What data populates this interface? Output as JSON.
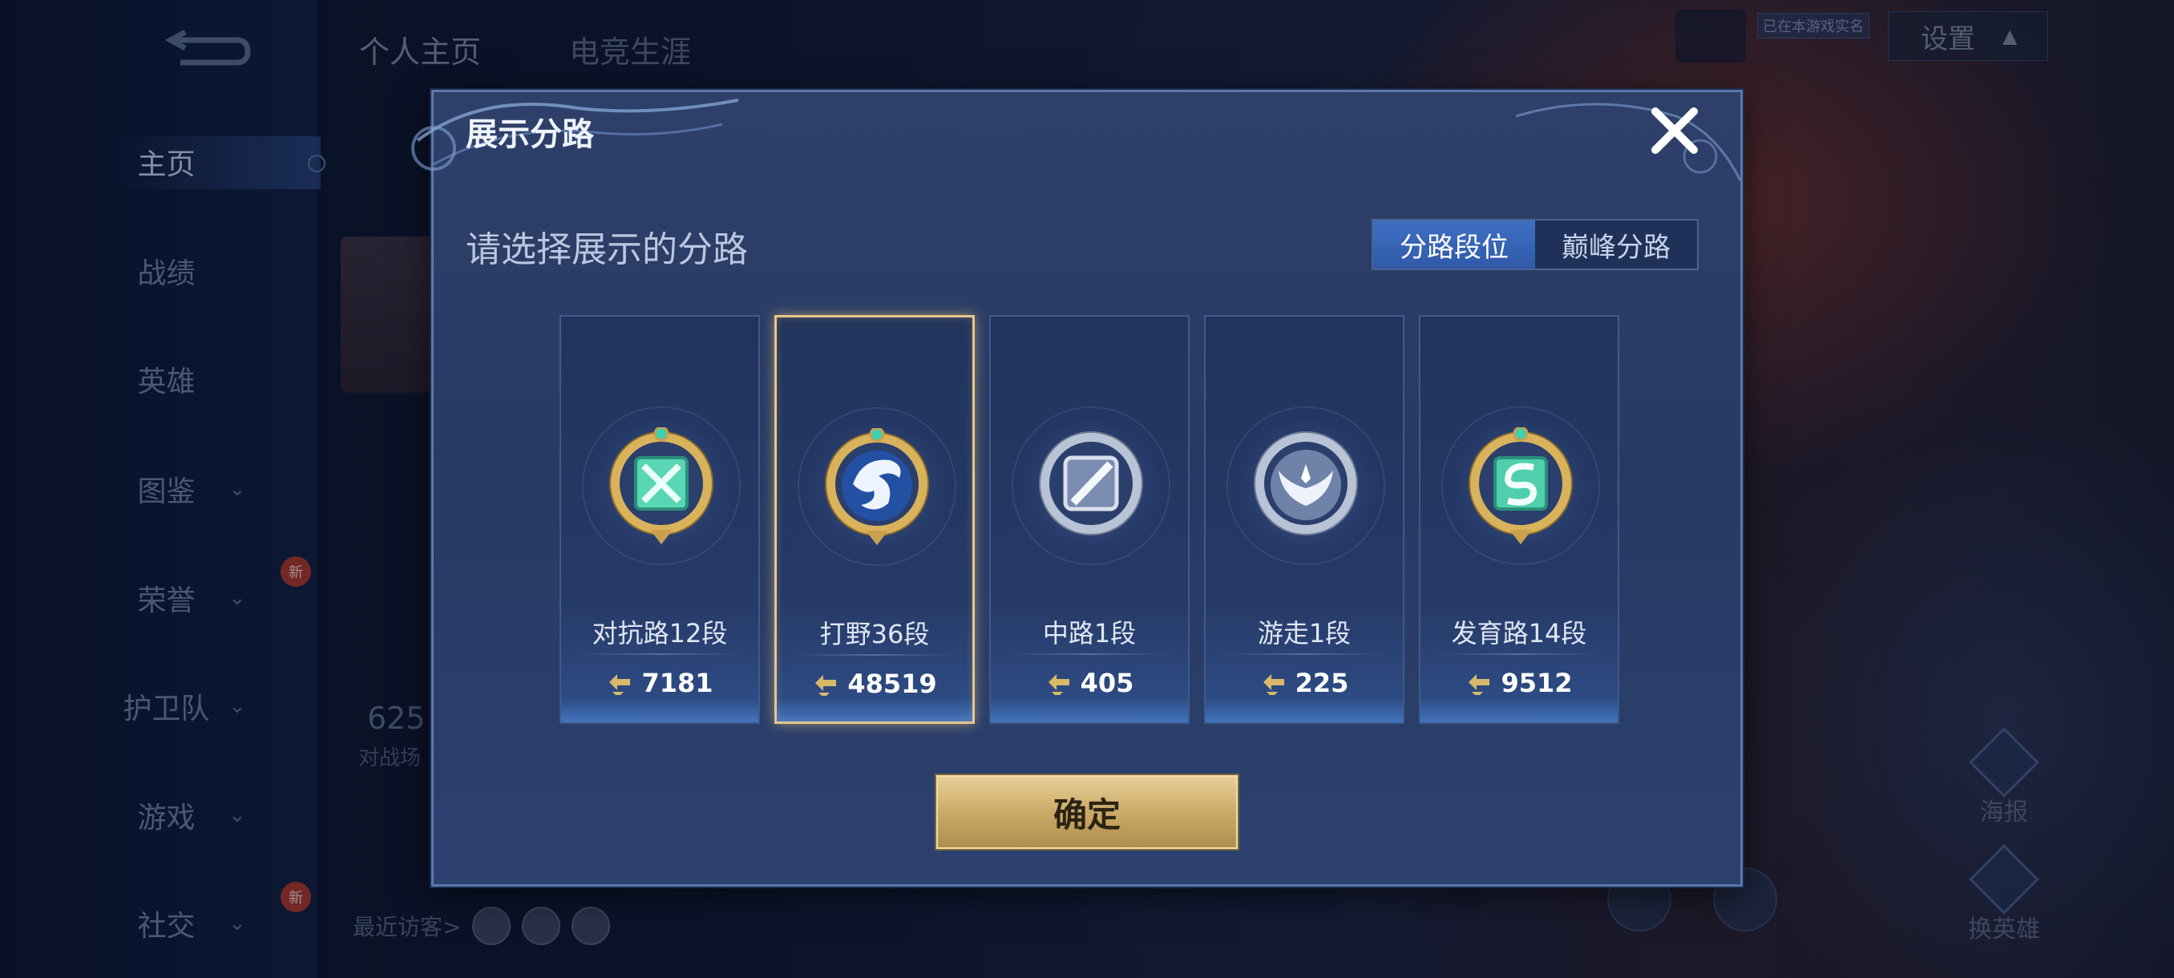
{
  "background": {
    "top_tabs": [
      "个人主页",
      "电竞生涯"
    ],
    "nav_items": [
      {
        "label": "主页",
        "active": true,
        "has_chevron": false,
        "badge": ""
      },
      {
        "label": "战绩",
        "active": false,
        "has_chevron": false,
        "badge": ""
      },
      {
        "label": "英雄",
        "active": false,
        "has_chevron": false,
        "badge": ""
      },
      {
        "label": "图鉴",
        "active": false,
        "has_chevron": true,
        "badge": ""
      },
      {
        "label": "荣誉",
        "active": false,
        "has_chevron": true,
        "badge": "新"
      },
      {
        "label": "护卫队",
        "active": false,
        "has_chevron": true,
        "badge": ""
      },
      {
        "label": "游戏",
        "active": false,
        "has_chevron": true,
        "badge": ""
      },
      {
        "label": "社交",
        "active": false,
        "has_chevron": true,
        "badge": "新"
      }
    ],
    "profile_number": "625",
    "profile_sub": "对战场",
    "recent_visitors_label": "最近访客>",
    "tag_text": "已在本游戏实名",
    "settings_label": "设置",
    "right_buttons": [
      "海报",
      "换英雄"
    ]
  },
  "modal": {
    "title": "展示分路",
    "section_title": "请选择展示的分路",
    "tabs": [
      {
        "label": "分路段位",
        "selected": true
      },
      {
        "label": "巅峰分路",
        "selected": false
      }
    ],
    "lanes": [
      {
        "name": "对抗路12段",
        "score": "7181",
        "selected": false,
        "emblem": "sword-emblem-icon",
        "tier": "gold"
      },
      {
        "name": "打野36段",
        "score": "48519",
        "selected": true,
        "emblem": "dragon-emblem-icon",
        "tier": "gold"
      },
      {
        "name": "中路1段",
        "score": "405",
        "selected": false,
        "emblem": "staff-emblem-icon",
        "tier": "silver"
      },
      {
        "name": "游走1段",
        "score": "225",
        "selected": false,
        "emblem": "wing-emblem-icon",
        "tier": "silver"
      },
      {
        "name": "发育路14段",
        "score": "9512",
        "selected": false,
        "emblem": "bow-emblem-icon",
        "tier": "gold"
      }
    ],
    "confirm_label": "确定"
  },
  "colors": {
    "accent_gold": "#e6c68a",
    "tab_selected": "#3f6fc3",
    "modal_bg": "#2b3d66"
  }
}
